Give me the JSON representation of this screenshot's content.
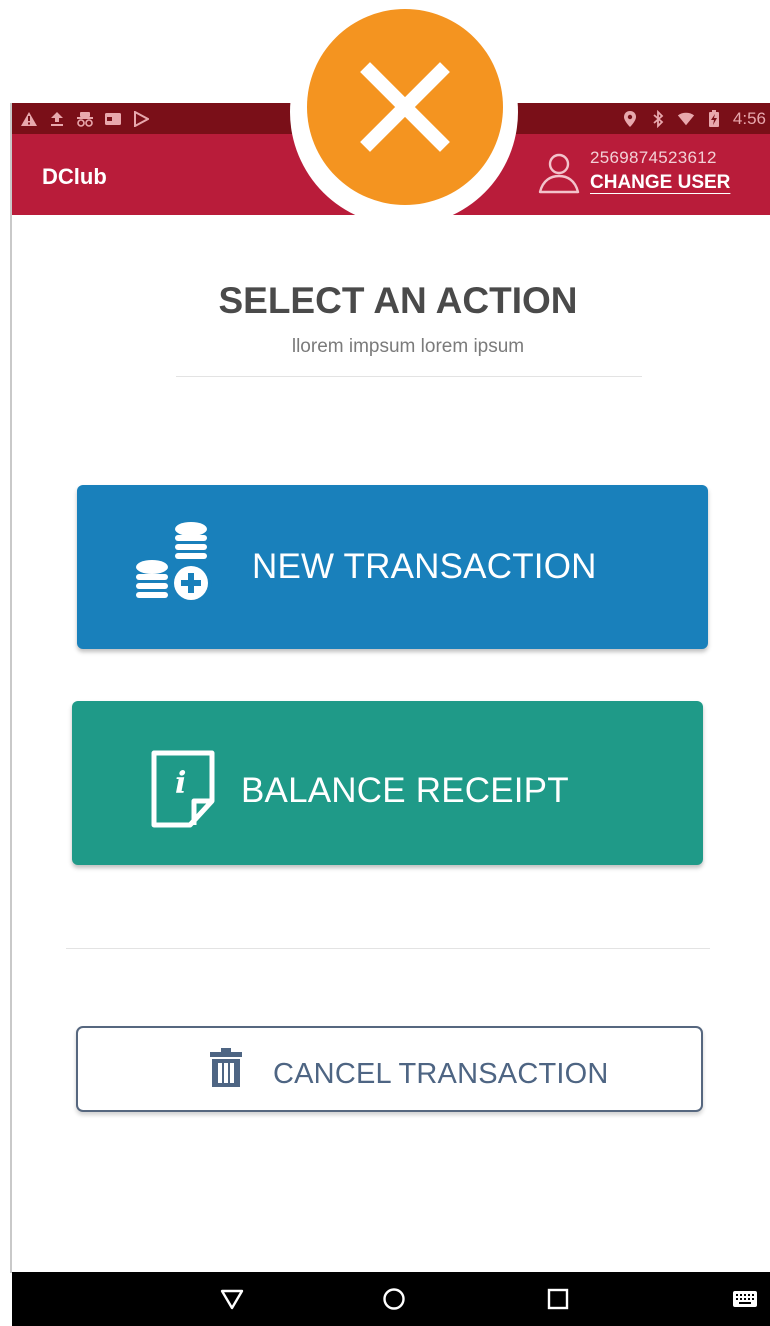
{
  "status_bar": {
    "left_icons": [
      "warning-icon",
      "upload-icon",
      "spy-icon",
      "card-icon",
      "play-store-icon"
    ],
    "right_icons": [
      "location-icon",
      "bluetooth-icon",
      "wifi-icon",
      "battery-icon"
    ],
    "time": "4:56"
  },
  "app_bar": {
    "title": "DClub",
    "user_id": "2569874523612",
    "change_user_label": "CHANGE USER"
  },
  "close_button": {
    "icon": "close-icon",
    "color": "#f49420"
  },
  "header": {
    "title": "SELECT AN ACTION",
    "subtitle": "llorem impsum lorem ipsum"
  },
  "actions": {
    "new_transaction": {
      "label": "NEW TRANSACTION",
      "icon": "coins-plus-icon",
      "color": "#1980bb"
    },
    "balance_receipt": {
      "label": "BALANCE RECEIPT",
      "icon": "info-document-icon",
      "color": "#1f9a88"
    },
    "cancel_transaction": {
      "label": "CANCEL TRANSACTION",
      "icon": "trash-icon",
      "color": "#4e6583"
    }
  },
  "nav_bar": {
    "buttons": [
      "back-icon",
      "home-icon",
      "recents-icon",
      "keyboard-icon"
    ]
  },
  "colors": {
    "app_bar": "#b91c3a",
    "status_bar": "#7a0f18"
  }
}
